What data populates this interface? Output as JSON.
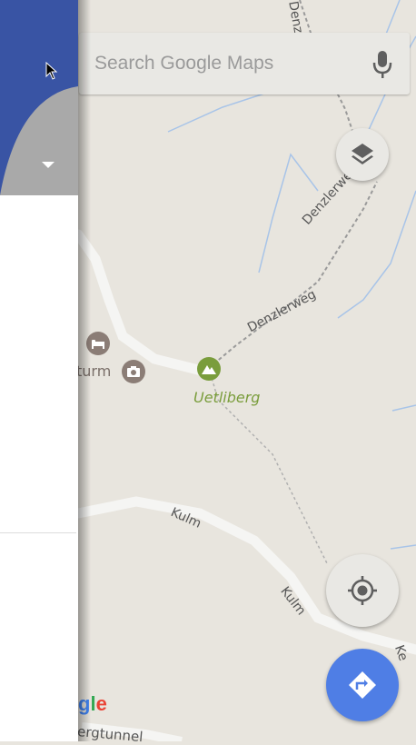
{
  "search": {
    "placeholder": "Search Google Maps"
  },
  "map": {
    "place_label": "Uetliberg",
    "road_labels": [
      "Denzlerweg",
      "Denzlerweg",
      "Denzle",
      "Kulm",
      "Kulm",
      "Ke"
    ],
    "partial_labels": {
      "poi1": "l",
      "poi2": "turm",
      "tunnel": "ergtunnel"
    },
    "logo_fragment": "gle"
  },
  "icons": {
    "mic": "mic-icon",
    "layers": "layers-icon",
    "locate": "my-location-icon",
    "directions": "directions-icon",
    "hotel": "hotel-icon",
    "camera": "camera-icon",
    "mountain": "mountain-icon",
    "cursor": "cursor-icon",
    "dropdown": "dropdown-arrow-icon"
  },
  "colors": {
    "map_bg": "#e8e5de",
    "drawer_blue": "#3954a4",
    "directions_fab": "#4f7ee5",
    "park_green": "#7a9d3c"
  }
}
